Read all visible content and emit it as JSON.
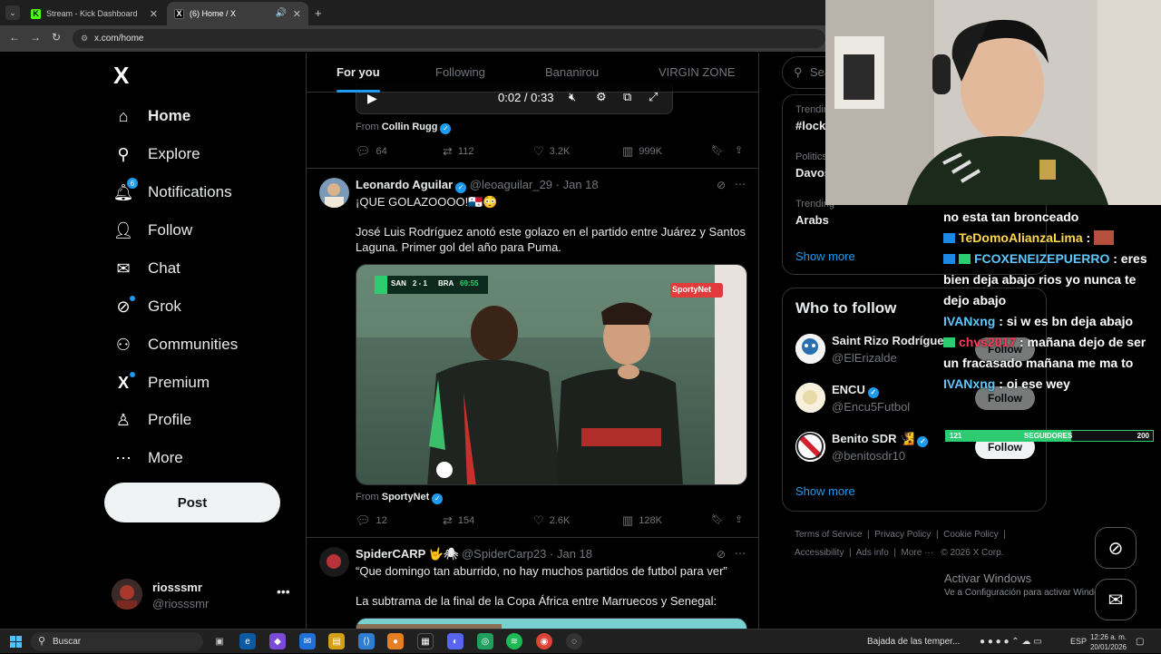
{
  "browser": {
    "tabs": [
      {
        "label": "Stream - Kick Dashboard",
        "favicon": "K"
      },
      {
        "label": "(6) Home / X",
        "favicon": "X"
      }
    ],
    "url": "x.com/home"
  },
  "nav": {
    "logo": "X",
    "items": [
      {
        "label": "Home",
        "icon": "home-icon"
      },
      {
        "label": "Explore",
        "icon": "search-icon"
      },
      {
        "label": "Notifications",
        "icon": "bell-icon",
        "badge": "6"
      },
      {
        "label": "Follow",
        "icon": "follow-icon"
      },
      {
        "label": "Chat",
        "icon": "mail-icon"
      },
      {
        "label": "Grok",
        "icon": "grok-icon"
      },
      {
        "label": "Communities",
        "icon": "communities-icon"
      },
      {
        "label": "Premium",
        "icon": "x-icon"
      },
      {
        "label": "Profile",
        "icon": "person-icon"
      },
      {
        "label": "More",
        "icon": "more-icon"
      }
    ],
    "post_label": "Post",
    "account": {
      "name": "riosssmr",
      "handle": "@riosssmr"
    }
  },
  "feed": {
    "tabs": [
      "For you",
      "Following",
      "Bananirou",
      "VIRGIN ZONE"
    ],
    "video_bar": {
      "time": "0:02 / 0:33"
    },
    "tweet0": {
      "from_prefix": "From",
      "from_name": "Collin Rugg",
      "replies": "64",
      "reposts": "112",
      "likes": "3.2K",
      "views": "999K"
    },
    "tweet1": {
      "name": "Leonardo Aguilar",
      "handle": "@leoaguilar_29",
      "date": "· Jan 18",
      "line1": "¡QUE GOLAZOOOO!🇵🇦😳",
      "body": "José Luis Rodríguez anotó este golazo en el partido entre Juárez y Santos Laguna. Primer gol del año para Puma.",
      "score_home": "SAN",
      "score": "2 - 1",
      "score_away": "BRA",
      "score_time": "69:55",
      "watermark": "SportyNet",
      "from_prefix": "From",
      "from_name": "SportyNet",
      "replies": "12",
      "reposts": "154",
      "likes": "2.6K",
      "views": "128K"
    },
    "tweet2": {
      "name": "SpiderCARP 🤟🕷",
      "handle": "@SpiderCarp23",
      "date": "· Jan 18",
      "line1": "“Que domingo tan aburrido, no hay muchos partidos de futbol para ver”",
      "line2": "La subtrama de la final de la Copa África entre Marruecos y Senegal:"
    }
  },
  "sidebar": {
    "search_placeholder": "Sea",
    "trends": [
      {
        "category": "Trendin",
        "name": "#lock"
      },
      {
        "category": "Politics",
        "name": "Davos"
      },
      {
        "category": "Trending",
        "name": "Arabs"
      }
    ],
    "show_more": "Show more",
    "who_to_follow_title": "Who to follow",
    "suggestions": [
      {
        "name": "Saint Rizo Rodríguez",
        "handle": "@ElErizalde"
      },
      {
        "name": "ENCU",
        "handle": "@Encu5Futbol"
      },
      {
        "name": "Benito SDR 🧏",
        "handle": "@benitosdr10"
      }
    ],
    "follow_label": "Follow",
    "show_more_2": "Show more",
    "footer": [
      "Terms of Service",
      "Privacy Policy",
      "Cookie Policy",
      "Accessibility",
      "Ads info",
      "More ···",
      "© 2026 X Corp."
    ]
  },
  "stream_overlay": {
    "chat": [
      {
        "user": "",
        "text": "no esta tan bronceado"
      },
      {
        "user": "TeDomoAlianzaLima",
        "text": ":"
      },
      {
        "user": "FCOXENEIZEPUERRO",
        "text": ": eres bien deja abajo rios yo nunca te dejo abajo"
      },
      {
        "user": "IVANxng",
        "text": ": si w es bn deja abajo"
      },
      {
        "user": "chvs2017",
        "text": ": mañana dejo de ser un fracasado mañana me ma to"
      },
      {
        "user": "IVANxng",
        "text": ": oi ese wey"
      }
    ],
    "goal": {
      "current": "121",
      "label": "SEGUIDORES",
      "target": "200",
      "fraction": 0.605
    }
  },
  "windows": {
    "activate_title": "Activar Windows",
    "activate_sub": "Ve a Configuración para activar Windows.",
    "search_placeholder": "Buscar",
    "weather": "Bajada de las temper...",
    "lang": "ESP",
    "time": "12:26 a. m.",
    "date": "20/01/2026"
  },
  "colors": {
    "accent": "#1d9bf0",
    "background": "#000000",
    "goal_green": "#2ecc71"
  }
}
